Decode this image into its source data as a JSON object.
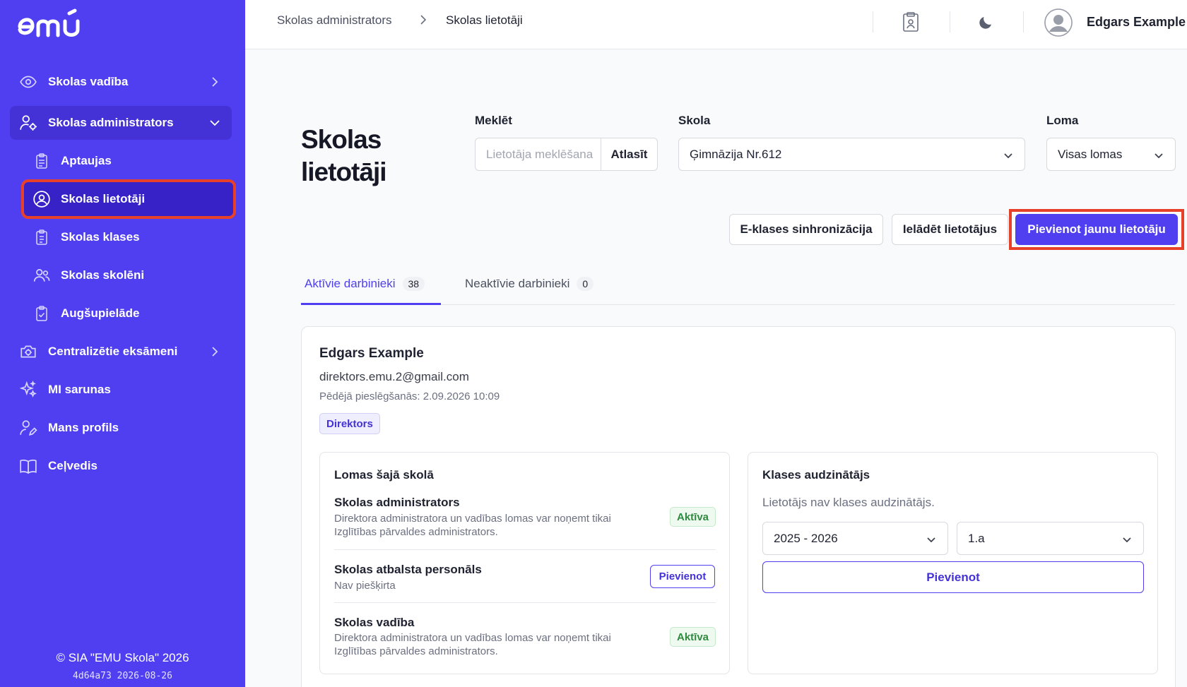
{
  "app": {
    "brand": "emu",
    "accent": "#4f3ff0",
    "highlight": "#e8412a"
  },
  "sidebar": {
    "items": [
      {
        "label": "Skolas vadība",
        "icon": "eye-icon"
      },
      {
        "label": "Skolas administrators",
        "icon": "user-gear-icon"
      },
      {
        "label": "Centralizētie eksāmeni",
        "icon": "camera-gear-icon"
      },
      {
        "label": "MI sarunas",
        "icon": "sparkles-icon"
      },
      {
        "label": "Mans profils",
        "icon": "user-edit-icon"
      },
      {
        "label": "Ceļvedis",
        "icon": "book-icon"
      }
    ],
    "subitems": [
      {
        "label": "Aptaujas",
        "icon": "clipboard-icon"
      },
      {
        "label": "Skolas lietotāji",
        "icon": "user-circle-icon"
      },
      {
        "label": "Skolas klases",
        "icon": "clipboard-list-icon"
      },
      {
        "label": "Skolas skolēni",
        "icon": "users-icon"
      },
      {
        "label": "Augšupielāde",
        "icon": "clipboard-check-icon"
      }
    ],
    "footer_copy": "© SIA \"EMU Skola\" 2026",
    "footer_version": "4d64a73 2026-08-26"
  },
  "header": {
    "breadcrumb": [
      "Skolas administrators",
      "Skolas lietotāji"
    ],
    "user_name": "Edgars Example"
  },
  "main": {
    "title": "Skolas lietotāji",
    "filters": {
      "search_label": "Meklēt",
      "search_placeholder": "Lietotāja meklēšana",
      "search_value": "",
      "filter_button": "Atlasīt",
      "school_label": "Skola",
      "school_value": "Ģimnāzija Nr.612",
      "role_label": "Loma",
      "role_value": "Visas lomas"
    },
    "actions": {
      "sync": "E-klases sinhronizācija",
      "import": "Ielādēt lietotājus",
      "add": "Pievienot jaunu lietotāju"
    },
    "tabs": [
      {
        "label": "Aktīvie darbinieki",
        "count": "38"
      },
      {
        "label": "Neaktīvie darbinieki",
        "count": "0"
      }
    ],
    "user": {
      "name": "Edgars Example",
      "email": "direktors.emu.2@gmail.com",
      "last_login": "Pēdējā pieslēgšanās: 2.09.2026 10:09",
      "role_badge": "Direktors",
      "roles_title": "Lomas šajā skolā",
      "roles": [
        {
          "name": "Skolas administrators",
          "desc": "Direktora administratora un vadības lomas var noņemt tikai Izglītības pārvaldes administrators.",
          "status": "Aktīva"
        },
        {
          "name": "Skolas atbalsta personāls",
          "desc": "Nav piešķirta",
          "action": "Pievienot"
        },
        {
          "name": "Skolas vadība",
          "desc": "Direktora administratora un vadības lomas var noņemt tikai Izglītības pārvaldes administrators.",
          "status": "Aktīva"
        }
      ],
      "homeroom": {
        "title": "Klases audzinātājs",
        "note": "Lietotājs nav klases audzinātājs.",
        "year_value": "2025 - 2026",
        "class_value": "1.a",
        "add_button": "Pievienot"
      }
    }
  }
}
